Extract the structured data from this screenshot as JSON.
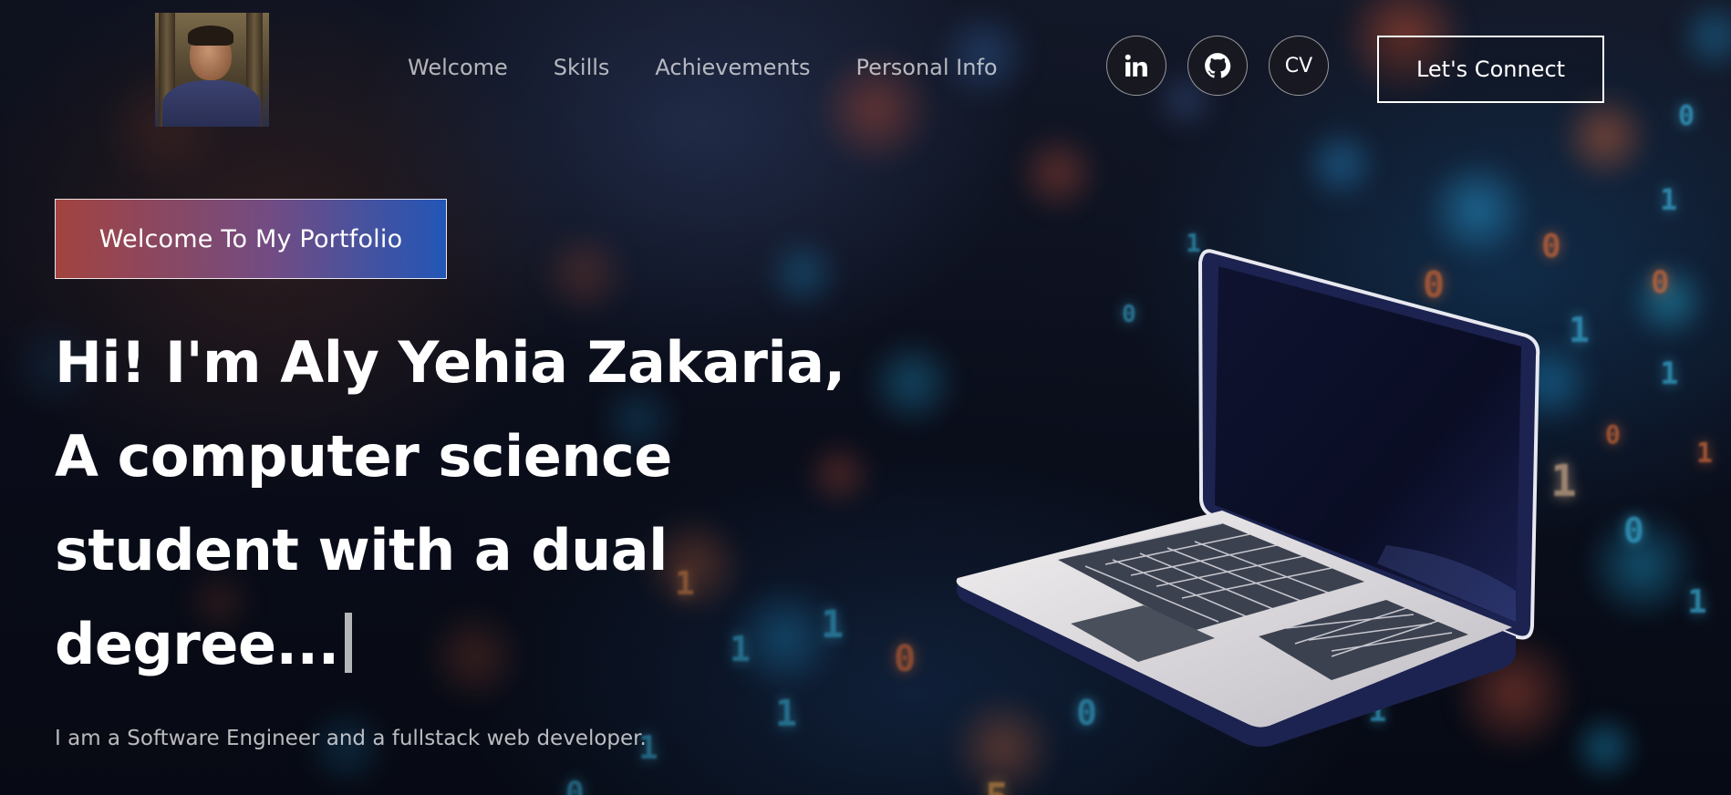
{
  "header": {
    "avatar_alt": "profile photo",
    "nav": [
      {
        "label": "Welcome"
      },
      {
        "label": "Skills"
      },
      {
        "label": "Achievements"
      },
      {
        "label": "Personal Info"
      }
    ],
    "social": [
      {
        "icon": "linkedin-icon"
      },
      {
        "icon": "github-icon"
      },
      {
        "icon": "cv-icon",
        "label": "CV"
      }
    ],
    "connect_label": "Let's Connect"
  },
  "hero": {
    "tagline": "Welcome To My Portfolio",
    "headline_lines": [
      "Hi! I'm Aly Yehia Zakaria,",
      "A computer science",
      "student with a dual",
      "degree..."
    ],
    "subtitle": "I am a Software Engineer and a fullstack web developer."
  },
  "colors": {
    "tagline_gradient_start": "#aa4641",
    "tagline_gradient_end": "#235abe",
    "laptop_body": "#1c2350",
    "laptop_deck": "#e4e2e2"
  }
}
